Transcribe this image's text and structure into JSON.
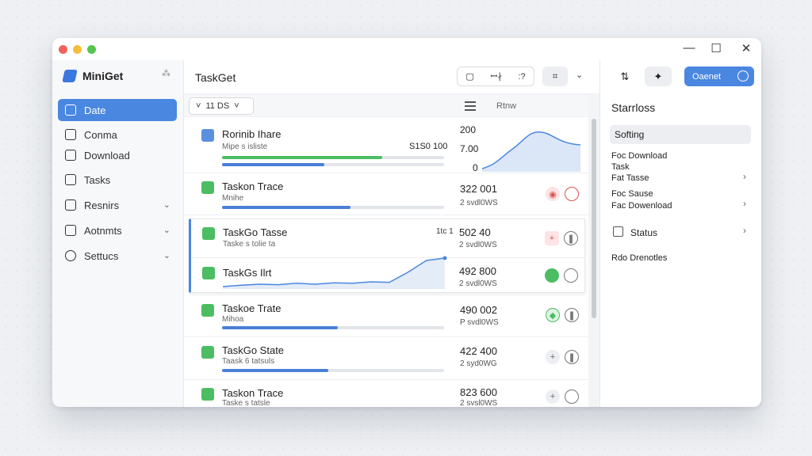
{
  "app": {
    "name": "MiniGet",
    "brand_extra": "⁂"
  },
  "window": {
    "minimize": "—",
    "maximize": "☐",
    "close": "✕"
  },
  "sidebar": {
    "items": [
      {
        "label": "Date",
        "icon": "grid-icon",
        "active": true
      },
      {
        "label": "Conma",
        "icon": "book-icon"
      },
      {
        "label": "Download",
        "icon": "file-icon"
      },
      {
        "label": "Tasks",
        "icon": "tasks-icon"
      },
      {
        "label": "Resnirs",
        "icon": "doc-icon",
        "chevron": true
      },
      {
        "label": "Aotnmts",
        "icon": "window-icon",
        "chevron": true
      },
      {
        "label": "Settucs",
        "icon": "gear-icon",
        "chevron": true
      }
    ]
  },
  "main": {
    "title": "TaskGet",
    "seg": {
      "a": "▢",
      "b": "ꟷ∤",
      "c": ":?"
    },
    "filter": {
      "value": "11 DS",
      "caret": "˅"
    },
    "sort_label": "Rtnw",
    "chart": {
      "ticks": [
        "200",
        "7.00",
        "0"
      ]
    },
    "rows": [
      {
        "title": "Rorinib Ihare",
        "sub": "Mipe s isliste",
        "speed": "S1S0 100",
        "progress": 0.72
      },
      {
        "title": "Taskon Trace",
        "sub": "Mnihe",
        "num": "322 001",
        "small": "2 svdl0WS",
        "progress": 0.58
      },
      {
        "title": "TaskGo Tasse",
        "sub": "Taske s tolie ta",
        "badge": "1tc 1",
        "num": "502 40",
        "small": "2 svdl0WS"
      },
      {
        "title": "TaskGs Ilrt",
        "num": "492 800",
        "small": "2 svdl0WS"
      },
      {
        "title": "Taskoe Trate",
        "sub": "Mihoa",
        "num": "490 002",
        "small": "P svdl0WS",
        "progress": 0.52
      },
      {
        "title": "TaskGo State",
        "sub": "Taask 6 tatsuls",
        "num": "422 400",
        "small": "2 syd0WG",
        "progress": 0.48
      },
      {
        "title": "Taskon Trace",
        "sub": "Taske s tatsle",
        "num": "823 600",
        "small": "2 svsl0WS"
      }
    ]
  },
  "trend": {
    "points": [
      0.05,
      0.08,
      0.1,
      0.09,
      0.12,
      0.1,
      0.13,
      0.12,
      0.15,
      0.14,
      0.35,
      0.6,
      0.65
    ]
  },
  "toolbar_right": {
    "btn1": "⇅",
    "btn2": "✦",
    "primary": "Oaenet"
  },
  "right_panel": {
    "title": "Starrloss",
    "setting": "Softing",
    "group1": [
      "Foc Download",
      "Task",
      "Fat Tasse"
    ],
    "group2": [
      "Foc Sause",
      "Fac Dowenload"
    ],
    "status": "Status",
    "footer": "Rdo Drenotles"
  }
}
